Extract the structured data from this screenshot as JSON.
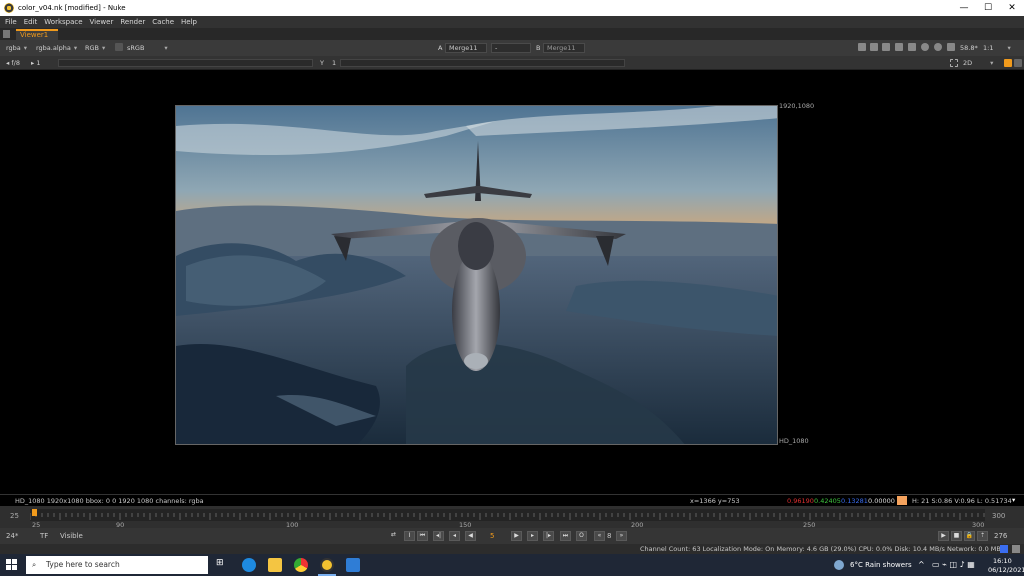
{
  "window": {
    "title": "color_v04.nk [modified] - Nuke",
    "min": "—",
    "max": "☐",
    "close": "✕"
  },
  "menu": [
    "File",
    "Edit",
    "Workspace",
    "Viewer",
    "Render",
    "Cache",
    "Help"
  ],
  "tab": {
    "label": "Viewer1"
  },
  "toolbar": {
    "channels": "rgba",
    "alpha": "rgba.alpha",
    "display": "RGB",
    "lut": "sRGB",
    "a_label": "A",
    "a_input": "Merge11",
    "op": "-",
    "b_label": "B",
    "b_input": "Merge11",
    "zoom": "58.8*",
    "ratio": "1:1",
    "mode": "2D",
    "fstop": "f/8",
    "frame": "1",
    "y_label": "Y",
    "y_value": "1"
  },
  "viewer": {
    "format_top": "1920,1080",
    "format_bottom": "HD_1080"
  },
  "info": {
    "left": "HD_1080 1920x1080  bbox: 0 0 1920 1080 channels: rgba",
    "coords": "x=1366 y=753",
    "r": "0.96190",
    "g": "0.42405",
    "b": "0.13281",
    "a": "0.00000",
    "hsv": "H: 21 S:0.86 V:0.96  L: 0.51734"
  },
  "timeline": {
    "in": "25",
    "out": "300",
    "current": "25",
    "ticks": [
      {
        "label": "25",
        "frame": 25
      },
      {
        "label": "90",
        "frame": 90
      },
      {
        "label": "100",
        "frame": 100
      },
      {
        "label": "150",
        "frame": 150
      },
      {
        "label": "200",
        "frame": 200
      },
      {
        "label": "250",
        "frame": 250
      },
      {
        "label": "300",
        "frame": 300
      }
    ]
  },
  "playback": {
    "fps": "24*",
    "tf": "TF",
    "visible": "Visible",
    "frame": "5",
    "step": "8",
    "end_frame": "276"
  },
  "status": {
    "text": "Channel Count: 63  Localization Mode: On  Memory: 4.6 GB (29.0%)  CPU: 0.0%  Disk: 10.4 MB/s  Network: 0.0 MB/s"
  },
  "taskbar": {
    "search_placeholder": "Type here to search",
    "weather": "6°C  Rain showers",
    "time": "16:10",
    "date": "06/12/2021"
  },
  "colors": {
    "accent": "#f09a1c",
    "red": "#e03030",
    "green": "#3ec43e",
    "blue": "#3a6df0"
  }
}
